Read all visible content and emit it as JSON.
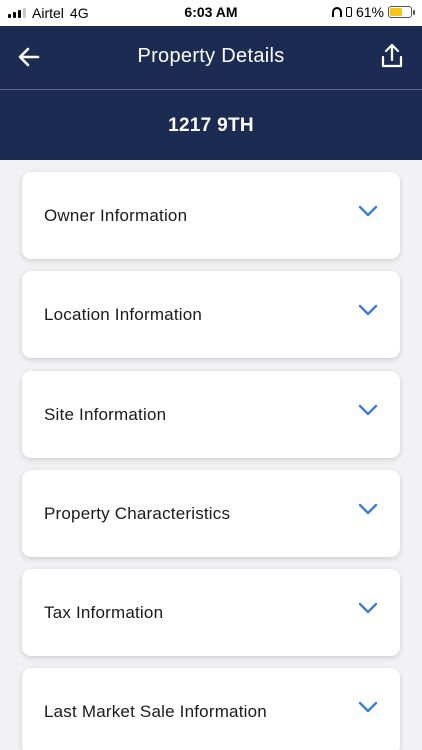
{
  "status_bar": {
    "carrier": "Airtel",
    "network": "4G",
    "time": "6:03 AM",
    "battery_percent": "61%",
    "battery_level": 0.61,
    "battery_color": "#f5c518"
  },
  "header": {
    "title": "Property Details",
    "back_icon": "arrow-left-icon",
    "share_icon": "share-upload-icon",
    "address": "1217 9TH",
    "background": "#1c2b52"
  },
  "sections": [
    {
      "label": "Owner Information",
      "icon": "chevron-down-icon"
    },
    {
      "label": "Location Information",
      "icon": "chevron-down-icon"
    },
    {
      "label": "Site Information",
      "icon": "chevron-down-icon"
    },
    {
      "label": "Property Characteristics",
      "icon": "chevron-down-icon"
    },
    {
      "label": "Tax Information",
      "icon": "chevron-down-icon"
    },
    {
      "label": "Last Market Sale Information",
      "icon": "chevron-down-icon"
    }
  ],
  "accent_color": "#3d7bd6"
}
